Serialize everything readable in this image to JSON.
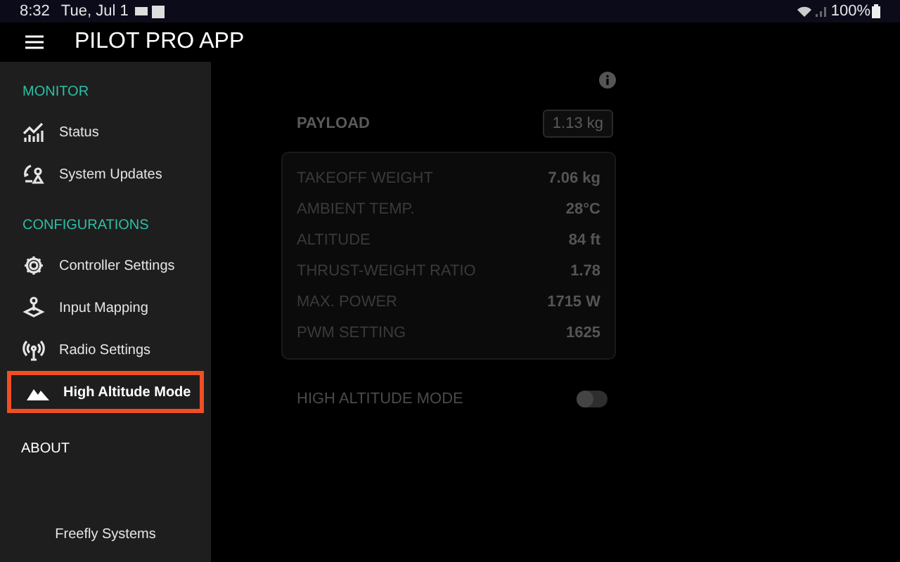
{
  "status_bar": {
    "time": "8:32",
    "date": "Tue, Jul 1",
    "battery": "100%"
  },
  "app_bar": {
    "title": "PILOT PRO APP"
  },
  "sidebar": {
    "sections": [
      {
        "title": "MONITOR",
        "items": [
          {
            "label": "Status",
            "selected": false
          },
          {
            "label": "System Updates",
            "selected": false
          }
        ]
      },
      {
        "title": "CONFIGURATIONS",
        "items": [
          {
            "label": "Controller Settings",
            "selected": false
          },
          {
            "label": "Input Mapping",
            "selected": false
          },
          {
            "label": "Radio Settings",
            "selected": false
          },
          {
            "label": "High Altitude Mode",
            "selected": true
          }
        ]
      }
    ],
    "about": "ABOUT",
    "footer": "Freefly Systems"
  },
  "payload": {
    "label": "PAYLOAD",
    "value": "1.13 kg"
  },
  "stats": [
    {
      "label": "TAKEOFF WEIGHT",
      "value": "7.06 kg"
    },
    {
      "label": "AMBIENT TEMP.",
      "value": "28°C"
    },
    {
      "label": "ALTITUDE",
      "value": "84 ft"
    },
    {
      "label": "THRUST-WEIGHT RATIO",
      "value": "1.78"
    },
    {
      "label": "MAX. POWER",
      "value": "1715 W"
    },
    {
      "label": "PWM SETTING",
      "value": "1625"
    }
  ],
  "high_altitude": {
    "label": "HIGH ALTITUDE MODE",
    "on": false
  }
}
